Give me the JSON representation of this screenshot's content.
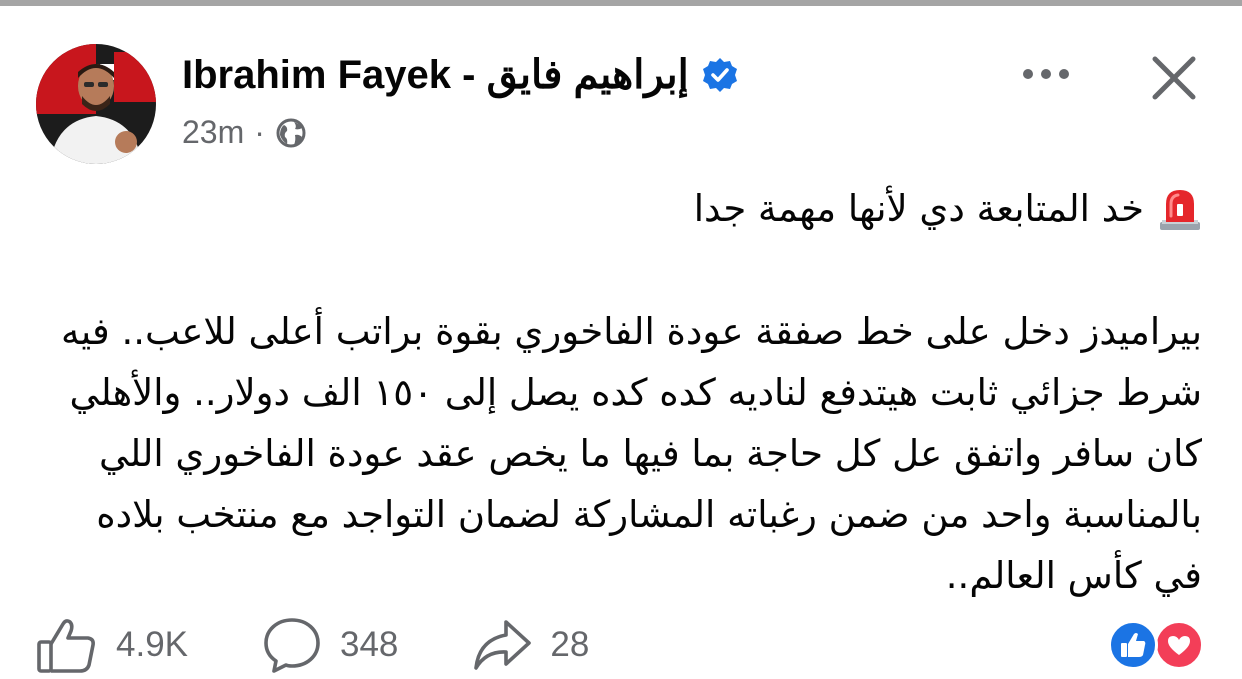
{
  "post": {
    "author_name": "Ibrahim Fayek - إبراهيم  فايق",
    "timestamp": "23m",
    "meta_separator": "·",
    "audience_icon": "globe-icon",
    "verified_icon": "verified-badge-icon",
    "header_actions": {
      "more_icon": "more-dots-icon",
      "close_icon": "close-icon"
    },
    "headline": "خد المتابعة دي لأنها مهمة جدا",
    "headline_emoji": "police-siren-emoji",
    "body": "بيراميدز دخل على خط صفقة عودة الفاخوري بقوة براتب أعلى للاعب.. فيه شرط جزائي ثابت هيتدفع لناديه كده كده يصل إلى ١٥٠ الف دولار.. والأهلي كان سافر واتفق عل كل حاجة بما فيها ما يخص عقد عودة الفاخوري اللي بالمناسبة واحد من ضمن رغباته المشاركة لضمان التواجد مع منتخب بلاده في كأس العالم.."
  },
  "actions": {
    "like": {
      "icon": "thumbs-up-icon",
      "count": "4.9K"
    },
    "comment": {
      "icon": "comment-bubble-icon",
      "count": "348"
    },
    "share": {
      "icon": "share-arrow-icon",
      "count": "28"
    }
  },
  "reactions": [
    "like-reaction-icon",
    "love-reaction-icon"
  ],
  "colors": {
    "text": "#050505",
    "secondary_text": "#65676b",
    "verified_blue": "#1b74e4",
    "like_blue": "#1b74e4",
    "love_red": "#f33e58",
    "top_rule": "#a5a5a5"
  }
}
